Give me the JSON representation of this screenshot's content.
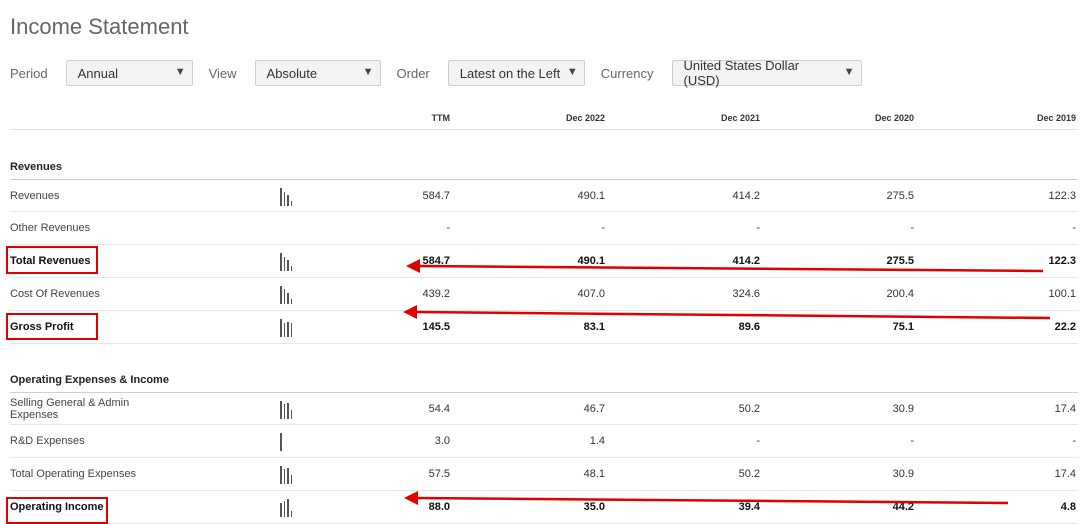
{
  "title": "Income Statement",
  "controls": {
    "period_label": "Period",
    "period_value": "Annual",
    "view_label": "View",
    "view_value": "Absolute",
    "order_label": "Order",
    "order_value": "Latest on the Left",
    "currency_label": "Currency",
    "currency_value": "United States Dollar (USD)"
  },
  "columns": [
    "TTM",
    "Dec 2022",
    "Dec 2021",
    "Dec 2020",
    "Dec 2019"
  ],
  "sections": {
    "revenues": "Revenues",
    "opex": "Operating Expenses & Income"
  },
  "rows": {
    "revenues": {
      "label": "Revenues",
      "values": [
        "584.7",
        "490.1",
        "414.2",
        "275.5",
        "122.3"
      ]
    },
    "other_revenues": {
      "label": "Other Revenues",
      "values": [
        "-",
        "-",
        "-",
        "-",
        "-"
      ]
    },
    "total_revenues": {
      "label": "Total Revenues",
      "values": [
        "584.7",
        "490.1",
        "414.2",
        "275.5",
        "122.3"
      ]
    },
    "cost_of_revenues": {
      "label": "Cost Of Revenues",
      "values": [
        "439.2",
        "407.0",
        "324.6",
        "200.4",
        "100.1"
      ]
    },
    "gross_profit": {
      "label": "Gross Profit",
      "values": [
        "145.5",
        "83.1",
        "89.6",
        "75.1",
        "22.2"
      ]
    },
    "sga": {
      "label": "Selling General & Admin Expenses",
      "values": [
        "54.4",
        "46.7",
        "50.2",
        "30.9",
        "17.4"
      ]
    },
    "rnd": {
      "label": "R&D Expenses",
      "values": [
        "3.0",
        "1.4",
        "-",
        "-",
        "-"
      ]
    },
    "total_opex": {
      "label": "Total Operating Expenses",
      "values": [
        "57.5",
        "48.1",
        "50.2",
        "30.9",
        "17.4"
      ]
    },
    "operating_income": {
      "label": "Operating Income",
      "values": [
        "88.0",
        "35.0",
        "39.4",
        "44.2",
        "4.8"
      ]
    }
  },
  "colors": {
    "highlight": "#e00000"
  }
}
